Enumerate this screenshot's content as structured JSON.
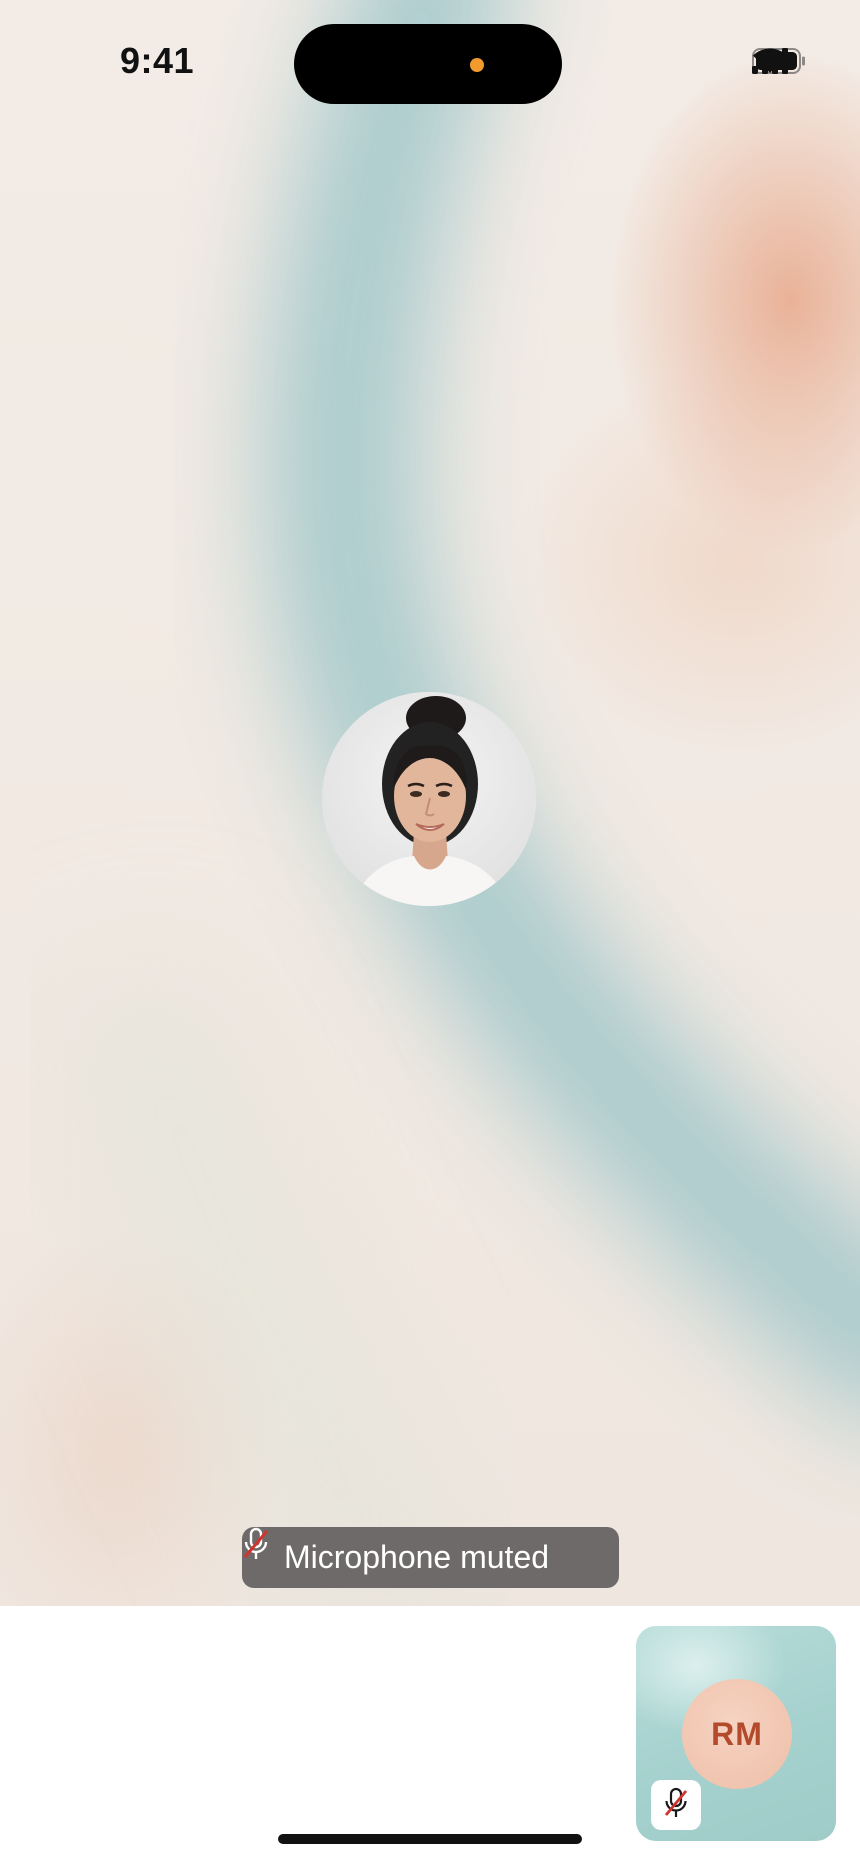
{
  "status_bar": {
    "time": "9:41",
    "icons": [
      "cellular-signal-icon",
      "wifi-icon",
      "battery-icon"
    ],
    "privacy_indicator_color": "#f29a2e"
  },
  "call": {
    "remote_participant": {
      "avatar": "participant-photo"
    },
    "toast": {
      "icon": "microphone-muted-icon",
      "text": "Microphone muted"
    },
    "self_view": {
      "initials": "RM",
      "mic_icon": "microphone-muted-icon"
    }
  },
  "colors": {
    "background_teal": "#9ec6c9",
    "background_peach": "#e8a88a",
    "muted_slash": "#d0342c",
    "initials_text": "#b24a2b"
  }
}
